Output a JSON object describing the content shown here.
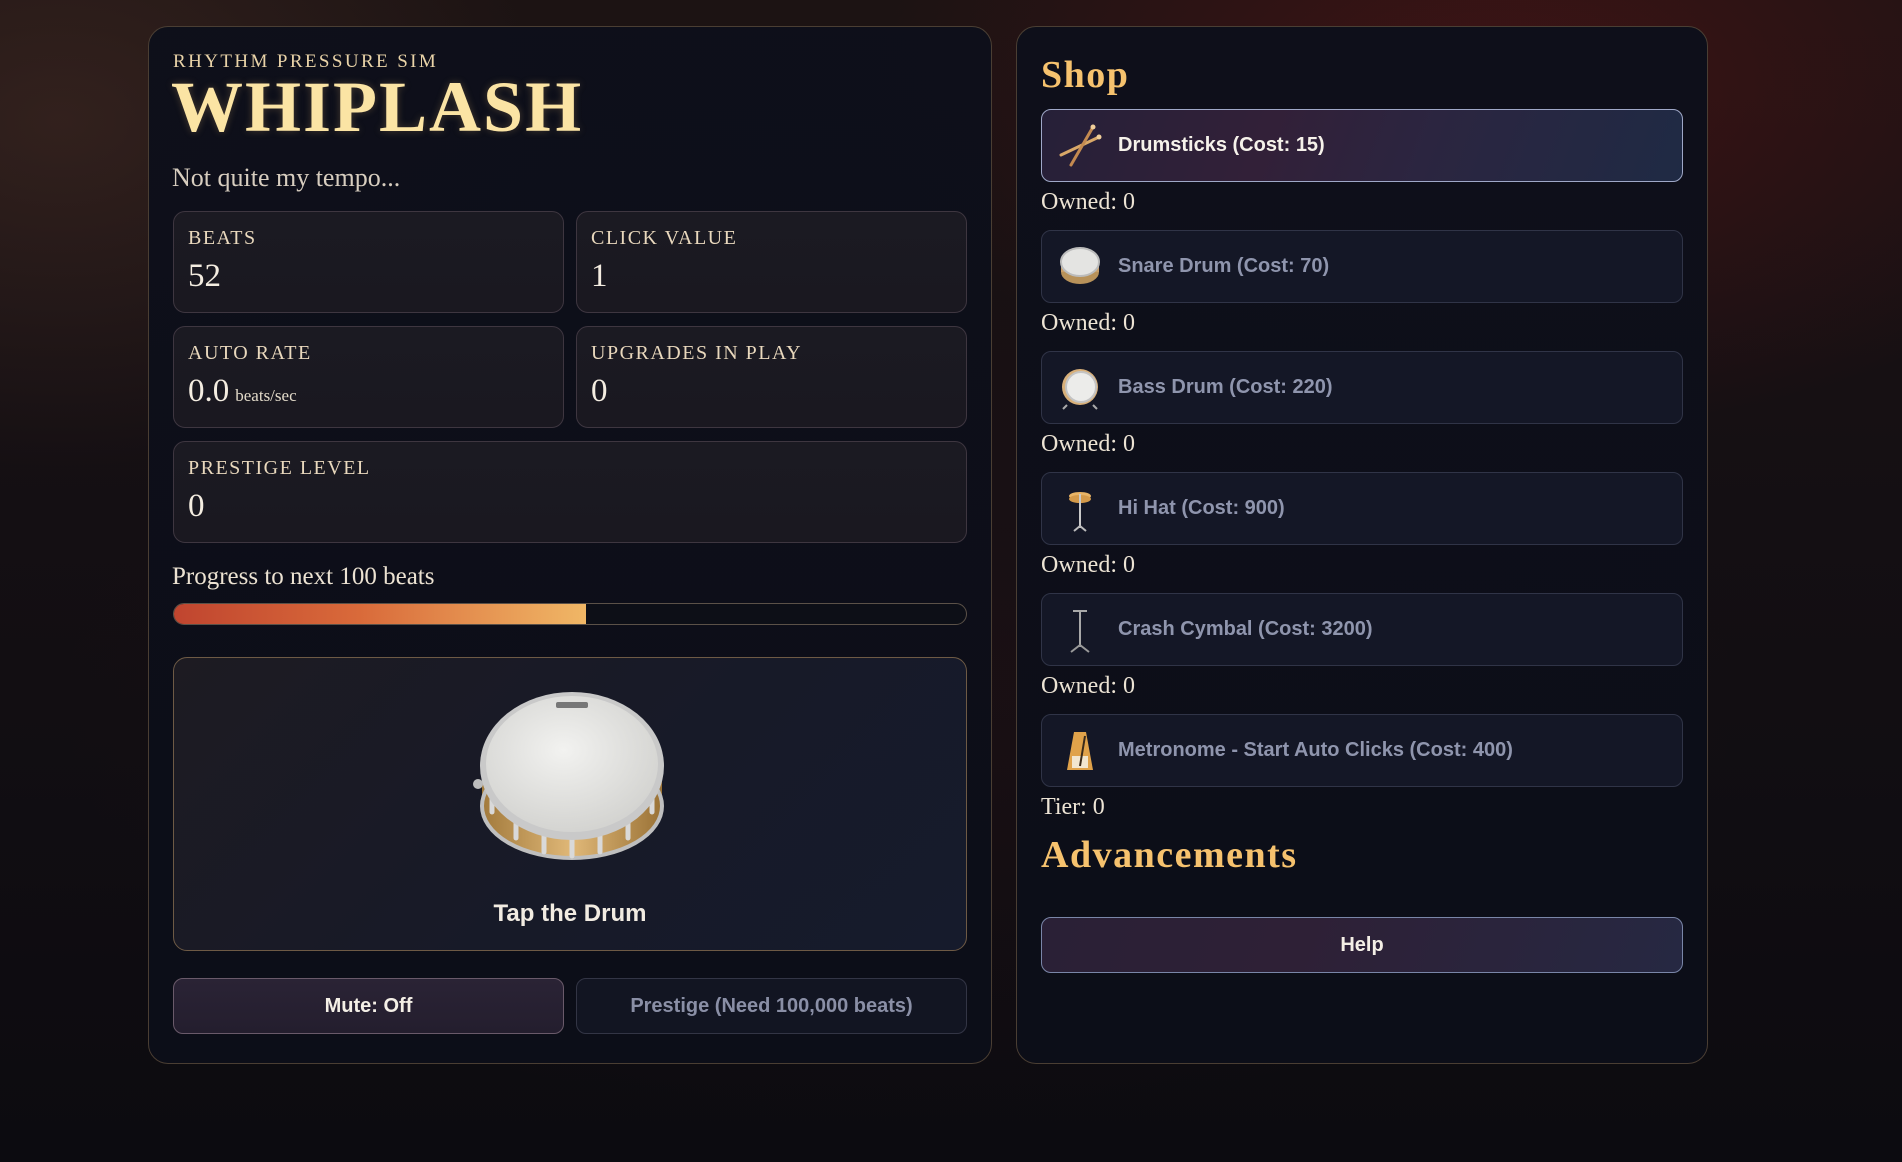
{
  "header": {
    "subtitle": "RHYTHM PRESSURE SIM",
    "title": "WHIPLASH",
    "tagline": "Not quite my tempo..."
  },
  "stats": {
    "beats": {
      "label": "BEATS",
      "value": "52"
    },
    "click_value": {
      "label": "CLICK VALUE",
      "value": "1"
    },
    "auto_rate": {
      "label": "AUTO RATE",
      "value": "0.0",
      "unit": "beats/sec"
    },
    "upgrades": {
      "label": "UPGRADES IN PLAY",
      "value": "0"
    },
    "prestige": {
      "label": "PRESTIGE LEVEL",
      "value": "0"
    }
  },
  "progress": {
    "label": "Progress to next 100 beats",
    "fraction": 0.52
  },
  "drum": {
    "label": "Tap the Drum",
    "icon": "snare-drum"
  },
  "controls": {
    "mute_label": "Mute: Off",
    "prestige_label": "Prestige (Need 100,000 beats)"
  },
  "shop": {
    "heading": "Shop",
    "items": [
      {
        "name": "Drumsticks (Cost: 15)",
        "owned": "Owned: 0",
        "icon": "drumsticks-icon",
        "affordable": true
      },
      {
        "name": "Snare Drum (Cost: 70)",
        "owned": "Owned: 0",
        "icon": "snare-drum-icon",
        "affordable": false
      },
      {
        "name": "Bass Drum (Cost: 220)",
        "owned": "Owned: 0",
        "icon": "bass-drum-icon",
        "affordable": false
      },
      {
        "name": "Hi Hat (Cost: 900)",
        "owned": "Owned: 0",
        "icon": "hi-hat-icon",
        "affordable": false
      },
      {
        "name": "Crash Cymbal (Cost: 3200)",
        "owned": "Owned: 0",
        "icon": "crash-cymbal-icon",
        "affordable": false
      },
      {
        "name": "Metronome - Start Auto Clicks (Cost: 400)",
        "owned": "Tier: 0",
        "icon": "metronome-icon",
        "affordable": false
      }
    ]
  },
  "advancements": {
    "heading": "Advancements"
  },
  "help": {
    "label": "Help"
  },
  "colors": {
    "accent_gold": "#f6c26e",
    "title_gold": "#fbe4a4",
    "progress_start": "#c0452f",
    "progress_end": "#f0b766"
  }
}
